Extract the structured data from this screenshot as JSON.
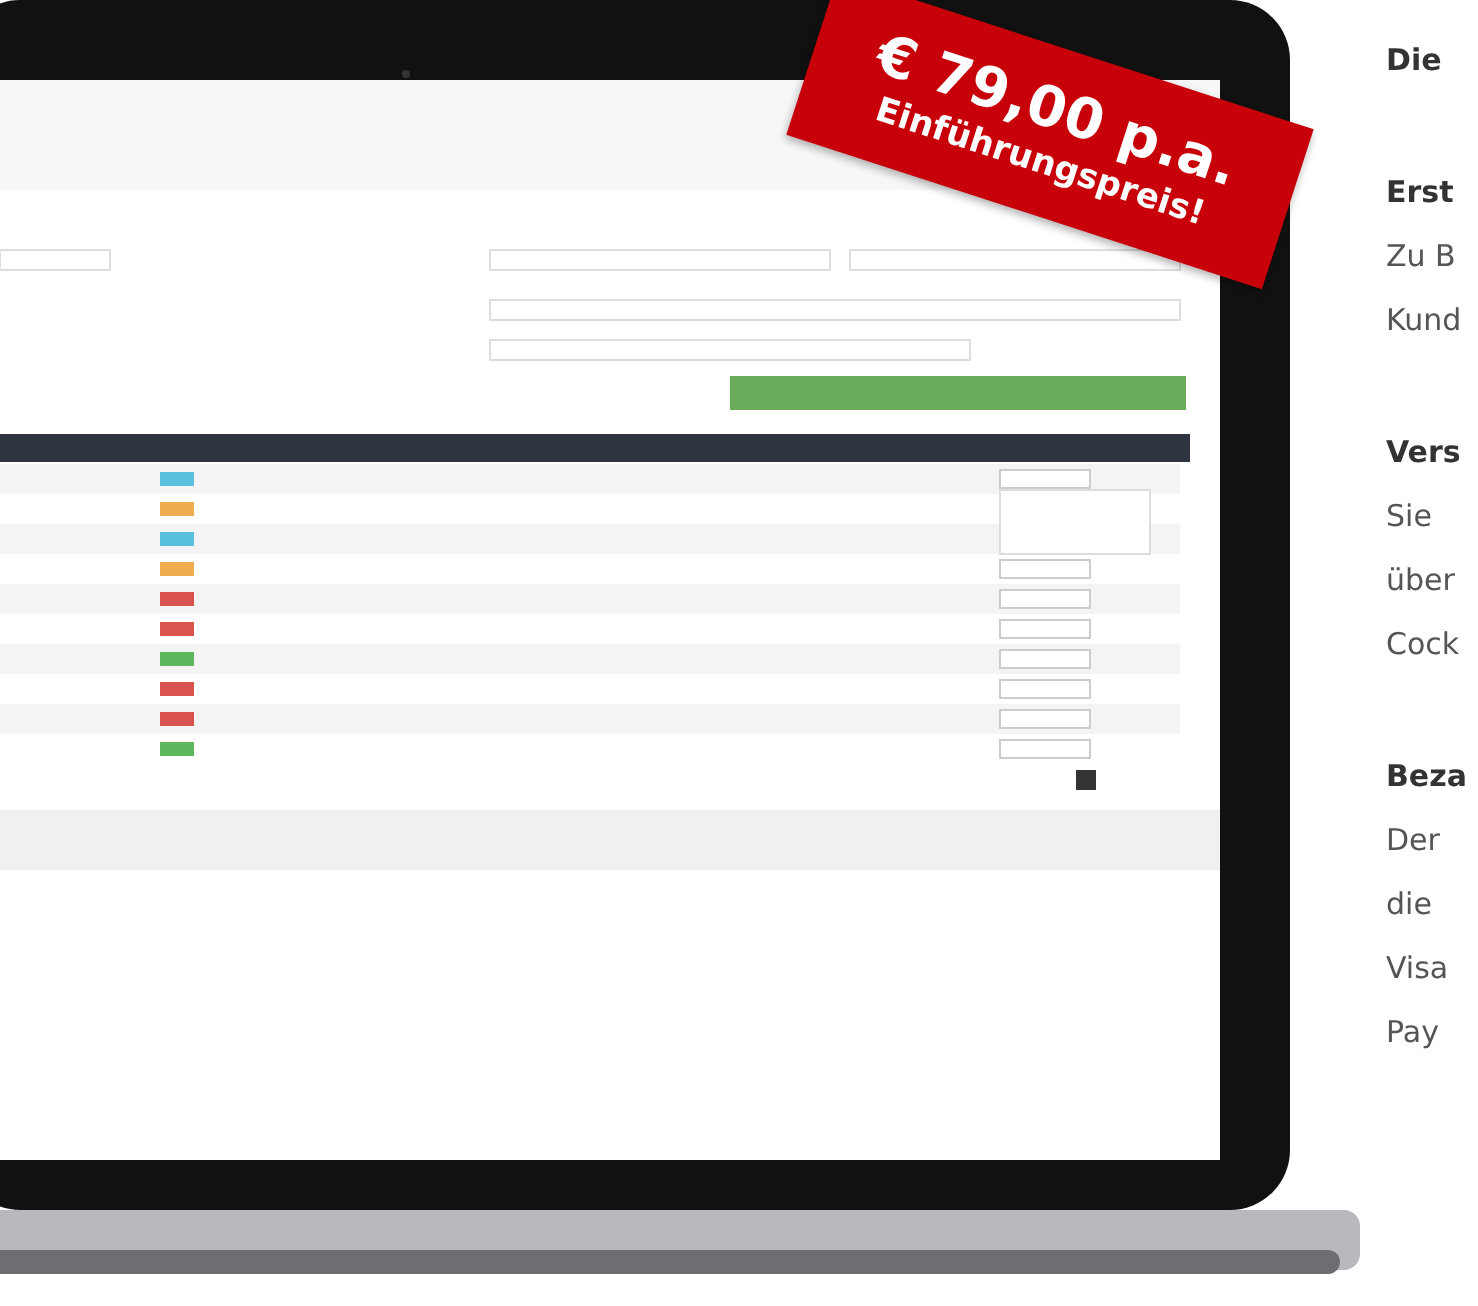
{
  "promo": {
    "price": "€ 79,00 p.a.",
    "note": "Einführungspreis!"
  },
  "intro_heading": "Die",
  "sections": [
    {
      "title": "Erst",
      "lines": [
        "Zu B",
        "Kund"
      ]
    },
    {
      "title": "Vers",
      "lines": [
        "Sie",
        "über",
        "Cock"
      ]
    },
    {
      "title": "Beza",
      "lines": [
        "Der",
        "die",
        "Visa",
        "Pay"
      ]
    }
  ]
}
